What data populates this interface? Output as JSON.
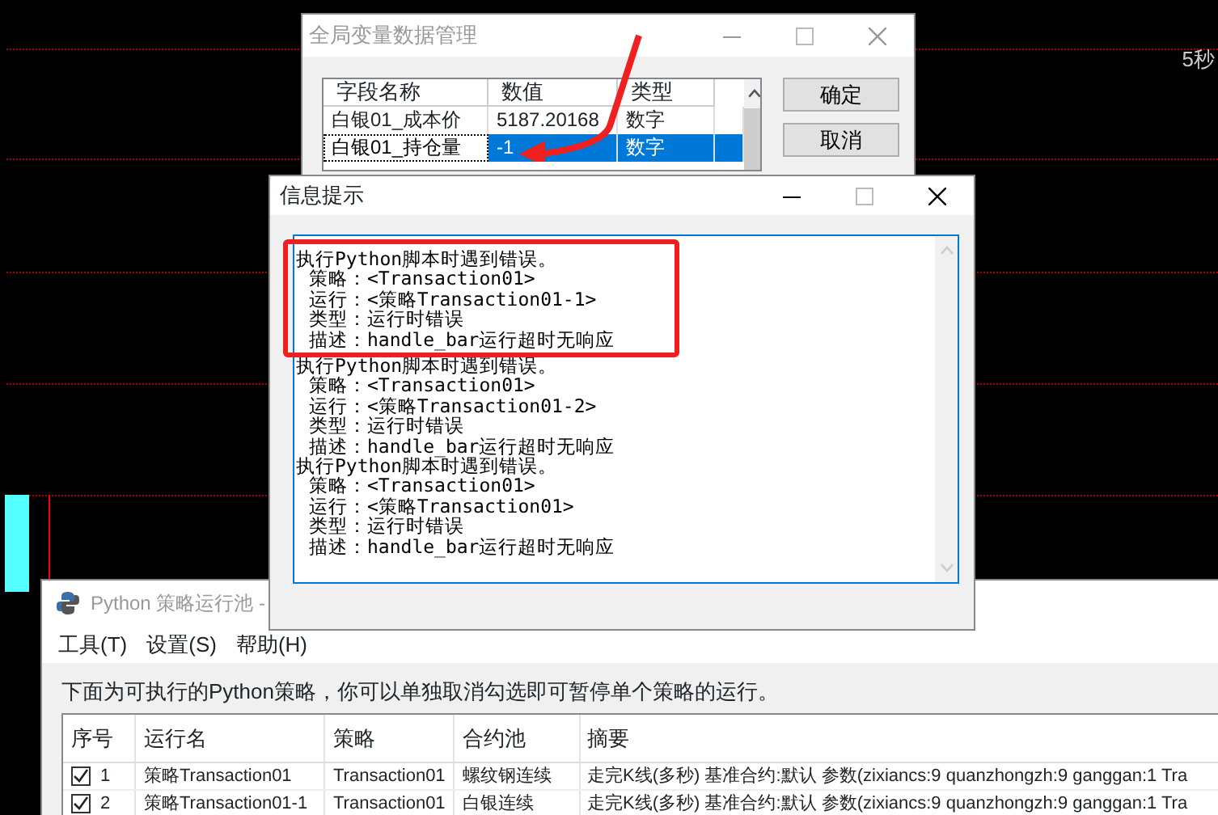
{
  "chart": {
    "period_label": "5秒"
  },
  "variables_window": {
    "title": "全局变量数据管理",
    "columns": [
      "字段名称",
      "数值",
      "类型"
    ],
    "rows": [
      {
        "name": "白银01_成本价",
        "value": "5187.20168",
        "type": "数字",
        "selected": false
      },
      {
        "name": "白银01_持仓量",
        "value": "-1",
        "type": "数字",
        "selected": true
      }
    ],
    "buttons": [
      "确定",
      "取消"
    ]
  },
  "message_window": {
    "title": "信息提示",
    "messages": [
      {
        "title": "执行Python脚本时遇到错误。",
        "highlighted": true,
        "lines": [
          "策略：<Transaction01>",
          "运行：<策略Transaction01-1>",
          "类型：运行时错误",
          "描述：handle_bar运行超时无响应"
        ]
      },
      {
        "title": "执行Python脚本时遇到错误。",
        "highlighted": false,
        "lines": [
          "策略：<Transaction01>",
          "运行：<策略Transaction01-2>",
          "类型：运行时错误",
          "描述：handle_bar运行超时无响应"
        ]
      },
      {
        "title": "执行Python脚本时遇到错误。",
        "highlighted": false,
        "lines": [
          "策略：<Transaction01>",
          "运行：<策略Transaction01>",
          "类型：运行时错误",
          "描述：handle_bar运行超时无响应"
        ]
      }
    ]
  },
  "pool_window": {
    "title": "Python 策略运行池 -",
    "menu": [
      "工具(T)",
      "设置(S)",
      "帮助(H)"
    ],
    "description": "下面为可执行的Python策略，你可以单独取消勾选即可暂停单个策略的运行。",
    "columns": [
      "序号",
      "运行名",
      "策略",
      "合约池",
      "摘要"
    ],
    "rows": [
      {
        "checked": true,
        "index": "1",
        "run_name": "策略Transaction01",
        "strategy": "Transaction01",
        "pool": "螺纹钢连续",
        "summary": "走完K线(多秒) 基准合约:默认 参数(zixiancs:9 quanzhongzh:9 ganggan:1 Tra"
      },
      {
        "checked": true,
        "index": "2",
        "run_name": "策略Transaction01-1",
        "strategy": "Transaction01",
        "pool": "白银连续",
        "summary": "走完K线(多秒) 基准合约:默认 参数(zixiancs:9 quanzhongzh:9 ganggan:1 Tra"
      }
    ]
  }
}
